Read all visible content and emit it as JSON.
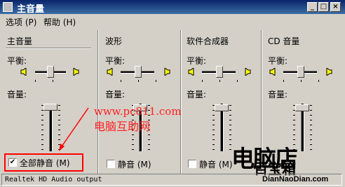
{
  "window": {
    "title": "主音量",
    "min": "_",
    "max": "□",
    "close": "×"
  },
  "menu": {
    "options": "选项 (P)",
    "help": "帮助 (H)"
  },
  "labels": {
    "balance": "平衡:",
    "volume": "音量:"
  },
  "channels": [
    {
      "name": "主音量",
      "mute_label": "全部静音 (M)",
      "muted": true
    },
    {
      "name": "波形",
      "mute_label": "静音 (M)",
      "muted": false
    },
    {
      "name": "软件合成器",
      "mute_label": "静音 (M)",
      "muted": false
    },
    {
      "name": "CD 音量",
      "mute_label": "静音 (M)",
      "muted": false
    }
  ],
  "status": "Realtek HD Audio output",
  "watermark": {
    "url": "www.pc811.com",
    "cn": "电脑互助网",
    "logo_big": "电脑店",
    "logo_mid": "百宝箱",
    "logo_small": "DianNaoDian.com"
  },
  "colors": {
    "titlebar": "#0a246a",
    "annotation": "#ff0000"
  },
  "icons": [
    "speaker-left-icon",
    "speaker-right-icon",
    "app-icon"
  ]
}
